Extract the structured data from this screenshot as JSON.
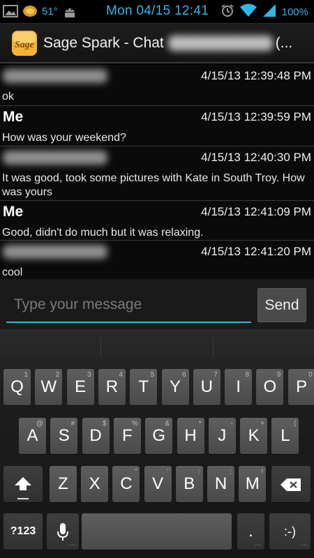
{
  "status_bar": {
    "temperature": "51°",
    "time": "Mon 04/15 12:41",
    "battery": "100%",
    "icons": [
      "picture-icon",
      "dropbox-badge-icon",
      "android-icon",
      "alarm-icon",
      "wifi-icon",
      "signal-icon"
    ]
  },
  "action_bar": {
    "logo_text": "Sage",
    "title_prefix": "Sage Spark - Chat",
    "title_suffix": "(..."
  },
  "messages": [
    {
      "sender": "",
      "sender_redacted": true,
      "time": "4/15/13 12:39:48 PM",
      "text": "ok"
    },
    {
      "sender": "Me",
      "sender_redacted": false,
      "time": "4/15/13 12:39:59 PM",
      "text": "How was your weekend?"
    },
    {
      "sender": "",
      "sender_redacted": true,
      "time": "4/15/13 12:40:30 PM",
      "text": "It was good, took some pictures with Kate in South Troy. How was yours"
    },
    {
      "sender": "Me",
      "sender_redacted": false,
      "time": "4/15/13 12:41:09 PM",
      "text": "Good, didn't do much but it was relaxing."
    },
    {
      "sender": "",
      "sender_redacted": true,
      "time": "4/15/13 12:41:20 PM",
      "text": "cool"
    }
  ],
  "compose": {
    "placeholder": "Type your message",
    "value": "",
    "send_label": "Send"
  },
  "keyboard": {
    "row1": [
      {
        "label": "Q",
        "hint": "1"
      },
      {
        "label": "W",
        "hint": "2"
      },
      {
        "label": "E",
        "hint": "3"
      },
      {
        "label": "R",
        "hint": "4"
      },
      {
        "label": "T",
        "hint": "5"
      },
      {
        "label": "Y",
        "hint": "6"
      },
      {
        "label": "U",
        "hint": "7"
      },
      {
        "label": "I",
        "hint": "8"
      },
      {
        "label": "O",
        "hint": "9"
      },
      {
        "label": "P",
        "hint": "0"
      }
    ],
    "row2": [
      {
        "label": "A",
        "hint": "@"
      },
      {
        "label": "S",
        "hint": "#"
      },
      {
        "label": "D",
        "hint": "$"
      },
      {
        "label": "F",
        "hint": "%"
      },
      {
        "label": "G",
        "hint": "&"
      },
      {
        "label": "H",
        "hint": "*"
      },
      {
        "label": "J",
        "hint": "-"
      },
      {
        "label": "K",
        "hint": "+"
      },
      {
        "label": "L",
        "hint": "("
      }
    ],
    "row3": [
      {
        "label": "Z",
        "hint": ""
      },
      {
        "label": "X",
        "hint": ""
      },
      {
        "label": "C",
        "hint": "\""
      },
      {
        "label": "V",
        "hint": "'"
      },
      {
        "label": "B",
        "hint": ":"
      },
      {
        "label": "N",
        "hint": ";"
      },
      {
        "label": "M",
        "hint": "!"
      }
    ],
    "symbols_label": "?123",
    "period_label": ".",
    "smiley_label": ":-)"
  }
}
